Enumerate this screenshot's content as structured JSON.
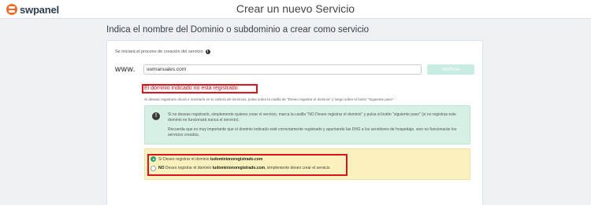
{
  "header": {
    "logo_text": "swpanel",
    "title": "Crear un nuevo Servicio"
  },
  "section_title": "Indica el nombre del Dominio o subdominio a crear como servicio",
  "form": {
    "intro": "Se iniciará el proceso de creación del servicio",
    "www_label": "www.",
    "domain_value": "swmanuales.com",
    "verify_label": "Verificar"
  },
  "status": {
    "error": "El dominio indicado no está registrado",
    "hint": "Si deseas registrarlo ahora e insertarlo en tu cartera de dominios, pulsa sobre la casilla de \"Deseo registrar el dominio\" y luego sobre el botón \"Siguiente paso\"."
  },
  "alert": {
    "p1": "Si no deseas registrarlo, simplemente quieres crear el servicio, marca la casilla \"NO Deseo registrar el dominio\" y pulsa el botón \"siguiente paso\" (si no registras este dominio no funcionará nunca el servicio).",
    "p2": "Recuerda que es muy importante que el dominio indicado esté correctamente registrado y apuntando las DNS a los servidores de hospedaje, sino no funcionarán los servicios creados."
  },
  "options": {
    "si_prefix": "Sí",
    "si_text": "Deseo registrar el dominio",
    "si_domain": "tudominionoregistrado.com",
    "no_prefix": "NO",
    "no_text": "Deseo registrar el dominio",
    "no_domain": "tudominionoregistrado.com",
    "no_suffix": ", simplemente deseo crear el servicio",
    "selected": "si"
  },
  "colors": {
    "brand": "#f26b2a",
    "error": "#e0111e",
    "alert_bg": "#d7f0e6",
    "option_bg": "#fbf1bd",
    "radio_selected": "#2f9e6d"
  },
  "icons": {
    "info": "info-icon",
    "alert": "exclamation-icon"
  }
}
